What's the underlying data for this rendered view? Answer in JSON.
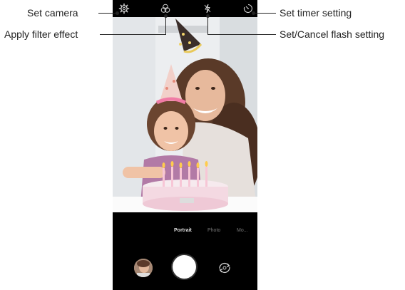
{
  "callouts": {
    "set_camera": "Set camera",
    "apply_filter": "Apply filter effect",
    "set_timer": "Set timer setting",
    "set_flash": "Set/Cancel flash setting"
  },
  "top_bar": {
    "icons": [
      "gear-icon",
      "filter-icon",
      "flash-off-icon",
      "timer-icon"
    ]
  },
  "camera_modes": {
    "items": [
      "Portrait",
      "Photo",
      "Mo..."
    ],
    "selected": "Portrait"
  },
  "controls": {
    "gallery": "gallery-thumbnail",
    "shutter": "shutter-button",
    "switch": "switch-camera-icon"
  },
  "colors": {
    "accent": "#222222",
    "phone_background": "#000000"
  }
}
